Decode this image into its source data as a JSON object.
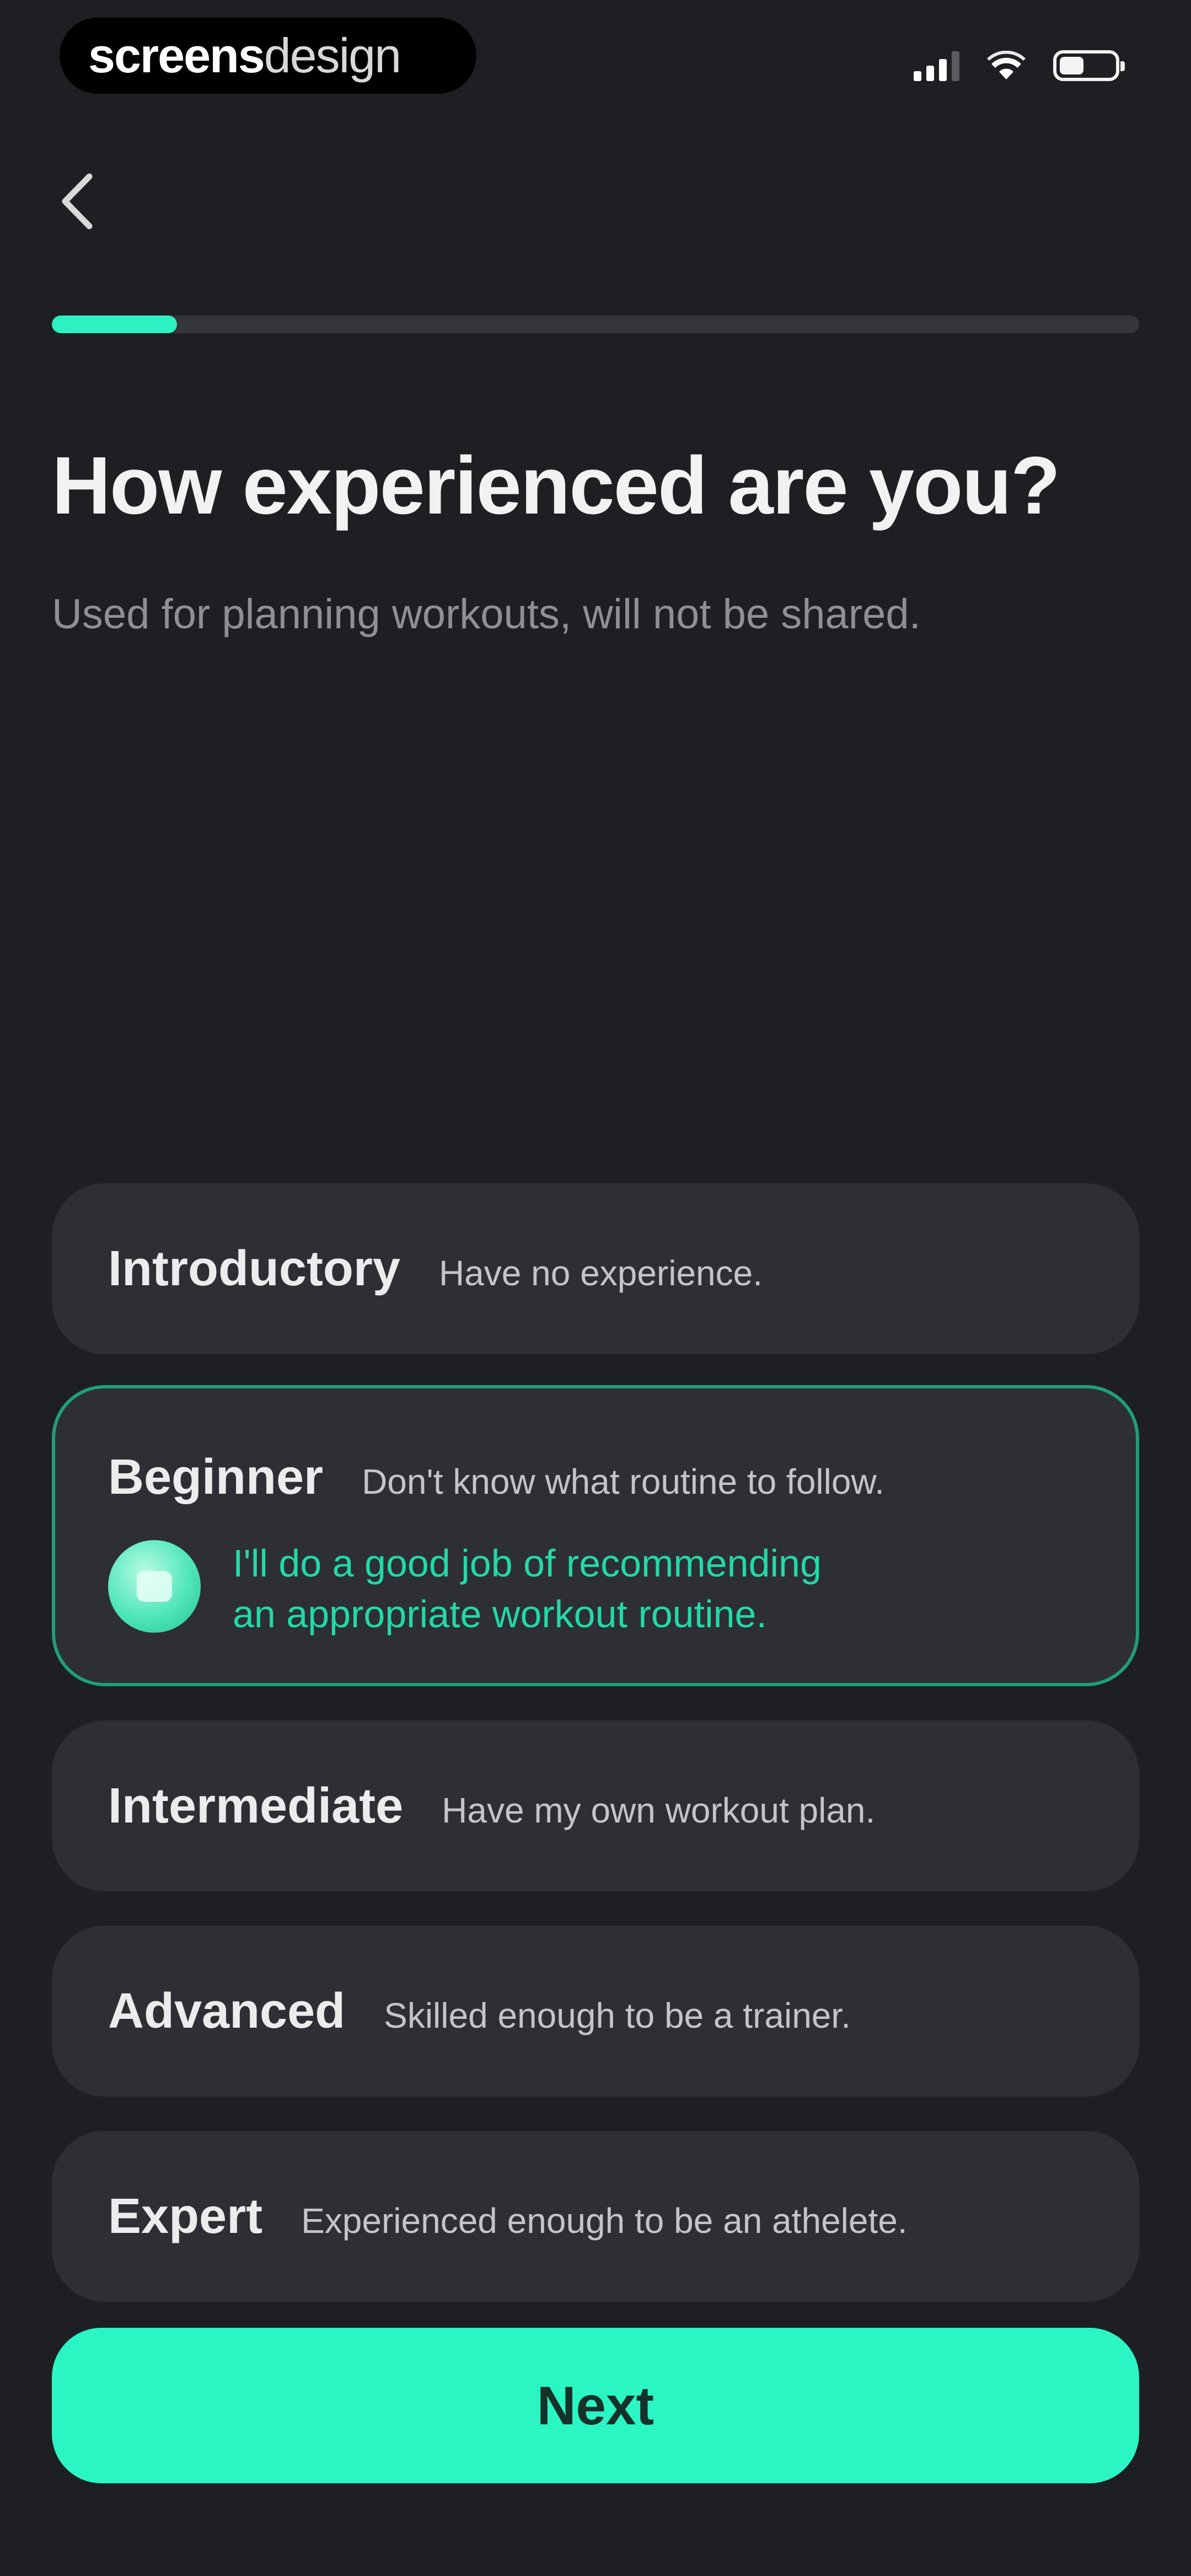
{
  "status_bar": {
    "brand_strong": "screens",
    "brand_light": "design",
    "signal_icon": "cellular-signal-icon",
    "wifi_icon": "wifi-icon",
    "battery_icon": "battery-icon",
    "battery_level": 0.45
  },
  "nav": {
    "back_icon": "chevron-left-icon"
  },
  "progress": {
    "fraction": 0.115,
    "color": "#2cf2c2"
  },
  "header": {
    "title": "How experienced are you?",
    "subtitle": "Used for planning workouts, will not be shared."
  },
  "options": [
    {
      "name": "Introductory",
      "description": "Have no experience.",
      "selected": false
    },
    {
      "name": "Beginner",
      "description": "Don't know what routine to follow.",
      "selected": true,
      "recommendation_line1": "I'll do a good job of recommending",
      "recommendation_line2": "an appropriate workout routine.",
      "recommendation_icon": "assistant-avatar-icon"
    },
    {
      "name": "Intermediate",
      "description": "Have my own workout plan.",
      "selected": false
    },
    {
      "name": "Advanced",
      "description": "Skilled enough to be a trainer.",
      "selected": false
    },
    {
      "name": "Expert",
      "description": "Experienced enough to be an athelete.",
      "selected": false
    }
  ],
  "footer": {
    "next_label": "Next"
  },
  "colors": {
    "background": "#1e1f23",
    "card": "#2d2f34",
    "accent": "#2cf5c4",
    "selected_border": "#1f9e7c",
    "recommendation_text": "#22d9a8"
  }
}
